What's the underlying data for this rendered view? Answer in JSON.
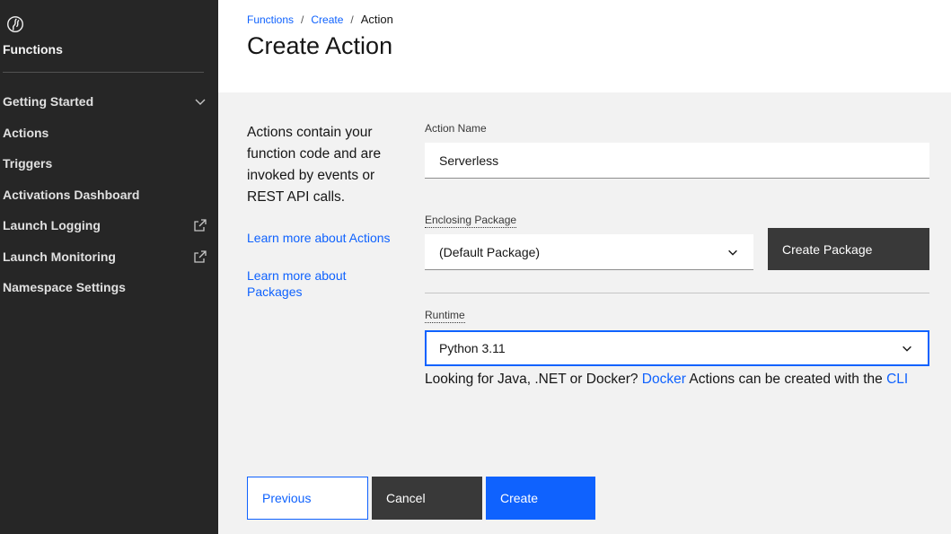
{
  "sidebar": {
    "brand_icon": "functions-icon",
    "title": "Functions",
    "items": [
      {
        "label": "Getting Started",
        "trail_icon": "chevron-down-icon"
      },
      {
        "label": "Actions"
      },
      {
        "label": "Triggers"
      },
      {
        "label": "Activations Dashboard"
      },
      {
        "label": "Launch Logging",
        "trail_icon": "launch-icon"
      },
      {
        "label": "Launch Monitoring",
        "trail_icon": "launch-icon"
      },
      {
        "label": "Namespace Settings"
      }
    ]
  },
  "breadcrumb": {
    "items": [
      "Functions",
      "Create"
    ],
    "separator": "/",
    "current": "Action"
  },
  "page": {
    "title": "Create Action"
  },
  "info": {
    "description": "Actions contain your function code and are invoked by events or REST API calls.",
    "link_actions": "Learn more about Actions",
    "link_packages": "Learn more about Packages"
  },
  "form": {
    "action_name": {
      "label": "Action Name",
      "value": "Serverless"
    },
    "package": {
      "label": "Enclosing Package",
      "value": "(Default Package)",
      "button": "Create Package"
    },
    "runtime": {
      "label": "Runtime",
      "value": "Python 3.11"
    },
    "hint": {
      "prefix": "Looking for Java, .NET or Docker? ",
      "docker_link": "Docker",
      "middle": " Actions can be created with the ",
      "cli_link": "CLI"
    }
  },
  "footer": {
    "previous": "Previous",
    "cancel": "Cancel",
    "create": "Create"
  },
  "colors": {
    "sidebar_bg": "#262626",
    "accent": "#0f62fe",
    "dark_button": "#393939",
    "content_bg": "#f2f2f2"
  }
}
